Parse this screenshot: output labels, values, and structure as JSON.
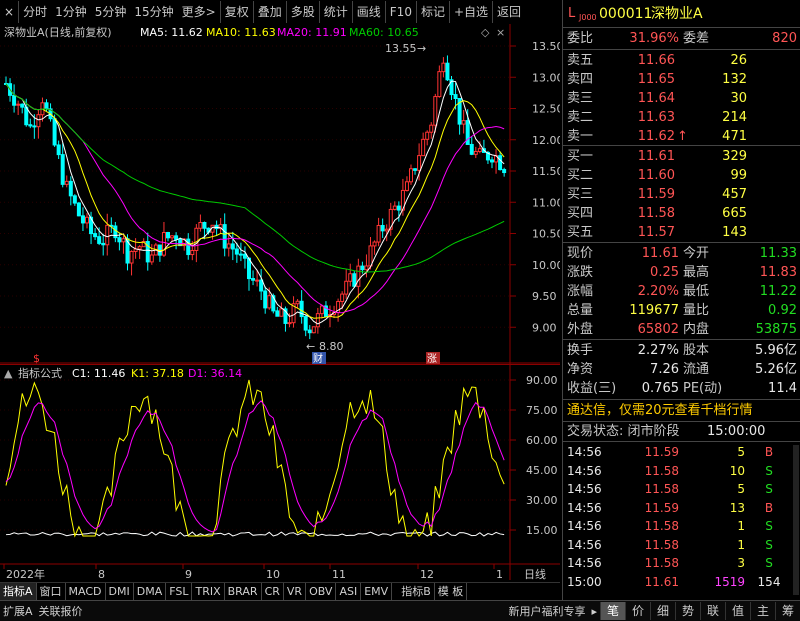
{
  "toolbar": {
    "close": "×",
    "items": [
      "分时",
      "1分钟",
      "5分钟",
      "15分钟",
      "更多>",
      "复权",
      "叠加",
      "多股",
      "统计",
      "画线",
      "F10",
      "标记",
      "+自选",
      "返回"
    ]
  },
  "main": {
    "legend": {
      "name": "深物业A(日线,前复权)",
      "ma5": "MA5: 11.62",
      "ma10": "MA10: 11.63",
      "ma20": "MA20: 11.91",
      "ma60": "MA60: 10.65"
    },
    "high_label": "13.55",
    "low_label": "8.80",
    "marker_cai": "财",
    "marker_zhang": "涨",
    "marker_dollar": "$",
    "yticks": [
      "13.50",
      "13.00",
      "12.50",
      "12.00",
      "11.50",
      "11.00",
      "10.50",
      "10.00",
      "9.50",
      "9.00"
    ]
  },
  "indicator": {
    "title": "指标公式",
    "c1": "C1: 11.46",
    "k1": "K1: 37.18",
    "d1": "D1: 36.14",
    "yticks": [
      "90.00",
      "75.00",
      "60.00",
      "45.00",
      "30.00",
      "15.00"
    ]
  },
  "xaxis": {
    "labels": [
      "2022年",
      "8",
      "9",
      "10",
      "11",
      "12",
      "1"
    ],
    "period": "日线"
  },
  "tabs": [
    "指标A",
    "窗口",
    "MACD",
    "DMI",
    "DMA",
    "FSL",
    "TRIX",
    "BRAR",
    "CR",
    "VR",
    "OBV",
    "ASI",
    "EMV",
    "指标B",
    "模 板"
  ],
  "bottom": {
    "left1": "扩展A",
    "left2": "关联报价",
    "promo": "新用户福利专享",
    "buttons": [
      "笔",
      "价",
      "细",
      "势",
      "联",
      "值",
      "主",
      "筹"
    ]
  },
  "panel": {
    "code_prefix": "L",
    "code_sub": "J000",
    "code": "000011",
    "name": "深物业A",
    "weibi_label": "委比",
    "weibi": "31.96%",
    "weicha_label": "委差",
    "weicha": "820",
    "asks": [
      {
        "label": "卖五",
        "price": "11.66",
        "vol": "26"
      },
      {
        "label": "卖四",
        "price": "11.65",
        "vol": "132"
      },
      {
        "label": "卖三",
        "price": "11.64",
        "vol": "30"
      },
      {
        "label": "卖二",
        "price": "11.63",
        "vol": "214"
      },
      {
        "label": "卖一",
        "price": "11.62",
        "vol": "471",
        "arrow": "↑"
      }
    ],
    "bids": [
      {
        "label": "买一",
        "price": "11.61",
        "vol": "329"
      },
      {
        "label": "买二",
        "price": "11.60",
        "vol": "99"
      },
      {
        "label": "买三",
        "price": "11.59",
        "vol": "457"
      },
      {
        "label": "买四",
        "price": "11.58",
        "vol": "665"
      },
      {
        "label": "买五",
        "price": "11.57",
        "vol": "143"
      }
    ],
    "quote": [
      {
        "l1": "现价",
        "v1": "11.61",
        "c1": "red",
        "l2": "今开",
        "v2": "11.33",
        "c2": "grn"
      },
      {
        "l1": "涨跌",
        "v1": "0.25",
        "c1": "red",
        "l2": "最高",
        "v2": "11.83",
        "c2": "red"
      },
      {
        "l1": "涨幅",
        "v1": "2.20%",
        "c1": "red",
        "l2": "最低",
        "v2": "11.22",
        "c2": "grn"
      },
      {
        "l1": "总量",
        "v1": "119677",
        "c1": "yel",
        "l2": "量比",
        "v2": "0.92",
        "c2": "grn"
      },
      {
        "l1": "外盘",
        "v1": "65802",
        "c1": "red",
        "l2": "内盘",
        "v2": "53875",
        "c2": "grn"
      }
    ],
    "quote2": [
      {
        "l1": "换手",
        "v1": "2.27%",
        "l2": "股本",
        "v2": "5.96亿"
      },
      {
        "l1": "净资",
        "v1": "7.26",
        "l2": "流通",
        "v2": "5.26亿"
      },
      {
        "l1": "收益(三)",
        "v1": "0.765",
        "l2": "PE(动)",
        "v2": "11.4"
      }
    ],
    "ad": "通达信，仅需20元查看千档行情",
    "status_label": "交易状态: 闭市阶段",
    "status_time": "15:00:00",
    "ticks": [
      {
        "t": "14:56",
        "p": "11.59",
        "v": "5",
        "s": "B"
      },
      {
        "t": "14:56",
        "p": "11.58",
        "v": "10",
        "s": "S"
      },
      {
        "t": "14:56",
        "p": "11.58",
        "v": "5",
        "s": "S"
      },
      {
        "t": "14:56",
        "p": "11.59",
        "v": "13",
        "s": "B"
      },
      {
        "t": "14:56",
        "p": "11.58",
        "v": "1",
        "s": "S"
      },
      {
        "t": "14:56",
        "p": "11.58",
        "v": "1",
        "s": "S"
      },
      {
        "t": "14:56",
        "p": "11.58",
        "v": "3",
        "s": "S"
      },
      {
        "t": "15:00",
        "p": "11.61",
        "v": "1519",
        "s": "154"
      }
    ]
  },
  "colors": {
    "up": "#ff3333",
    "down": "#00ffff",
    "ma5": "#ffffff",
    "ma10": "#ffff00",
    "ma20": "#ff00ff",
    "ma60": "#00cc00"
  }
}
